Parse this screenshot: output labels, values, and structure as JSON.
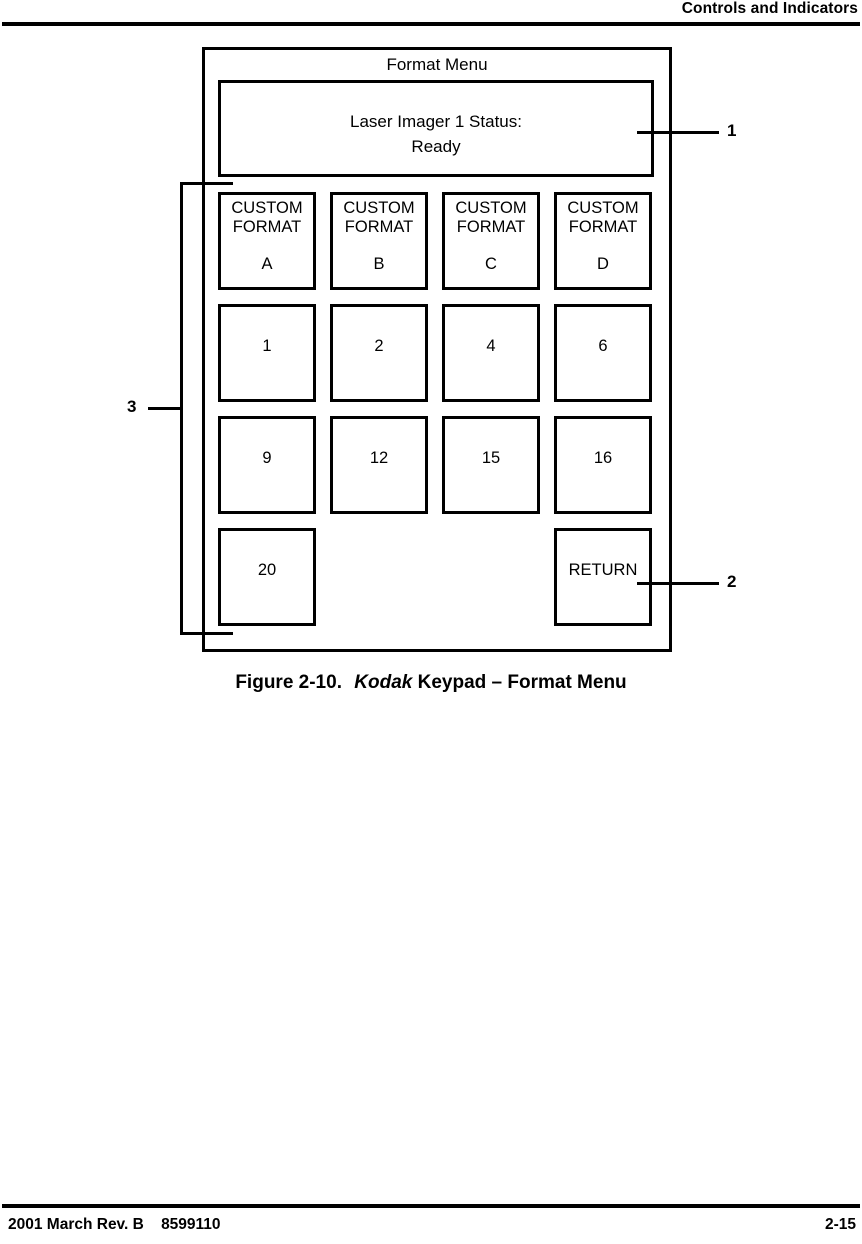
{
  "header": {
    "title": "Controls and Indicators"
  },
  "figure": {
    "keypad": {
      "title": "Format Menu",
      "display": {
        "line1": "Laser Imager 1 Status:",
        "line2": "Ready"
      },
      "rows": [
        {
          "keys": [
            {
              "top": "CUSTOM\nFORMAT",
              "bottom": "A",
              "name": "key-custom-format-a"
            },
            {
              "top": "CUSTOM\nFORMAT",
              "bottom": "B",
              "name": "key-custom-format-b"
            },
            {
              "top": "CUSTOM\nFORMAT",
              "bottom": "C",
              "name": "key-custom-format-c"
            },
            {
              "top": "CUSTOM\nFORMAT",
              "bottom": "D",
              "name": "key-custom-format-d"
            }
          ]
        },
        {
          "keys": [
            {
              "mid": "1",
              "name": "key-1"
            },
            {
              "mid": "2",
              "name": "key-2"
            },
            {
              "mid": "4",
              "name": "key-4"
            },
            {
              "mid": "6",
              "name": "key-6"
            }
          ]
        },
        {
          "keys": [
            {
              "mid": "9",
              "name": "key-9"
            },
            {
              "mid": "12",
              "name": "key-12"
            },
            {
              "mid": "15",
              "name": "key-15"
            },
            {
              "mid": "16",
              "name": "key-16"
            }
          ]
        },
        {
          "keys": [
            {
              "mid": "20",
              "name": "key-20"
            },
            {
              "mid": "",
              "blank": true,
              "name": "key-blank-1"
            },
            {
              "mid": "",
              "blank": true,
              "name": "key-blank-2"
            },
            {
              "mid": "RETURN",
              "name": "key-return"
            }
          ]
        }
      ]
    },
    "callouts": {
      "one": "1",
      "two": "2",
      "three": "3"
    },
    "caption": {
      "number": "Figure 2-10.",
      "brand": "Kodak",
      "rest": "Keypad – Format Menu"
    }
  },
  "footer": {
    "left": "2001 March Rev. B    8599110",
    "page": "2-15"
  }
}
